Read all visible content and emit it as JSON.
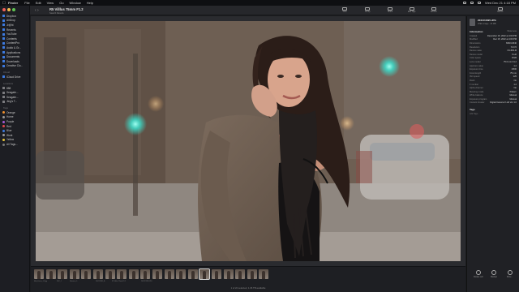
{
  "menubar": {
    "app": "Finder",
    "items": [
      "File",
      "Edit",
      "View",
      "Go",
      "Window",
      "Help"
    ],
    "clock": "Wed Dec 21 4:18 PM"
  },
  "sidebar": {
    "favorites_items": [
      "Dropbox",
      "AirDrop",
      "Jr@ht",
      "Recents",
      "YouTube",
      "Contents",
      "ContentPro",
      "Audio & Gr...",
      "Applications",
      "Documents",
      "Downloads",
      "Creative Clo..."
    ],
    "icloud_head": "iCloud",
    "icloud_items": [
      "iCloud Drive"
    ],
    "locations_head": "Locations",
    "locations_items": [
      "888",
      "Seagate...",
      "Seagate...",
      "Jing's T..."
    ],
    "tags_head": "Tags",
    "tags": [
      {
        "label": "Orange",
        "color": "#f0902c"
      },
      {
        "label": "Home",
        "color": "#9a9a9a"
      },
      {
        "label": "Purple",
        "color": "#a25ad6"
      },
      {
        "label": "Red",
        "color": "#e5484d"
      },
      {
        "label": "Blue",
        "color": "#3d7be0"
      },
      {
        "label": "Work",
        "color": "#9a9a9a"
      },
      {
        "label": "Yellow",
        "color": "#e8c53a"
      },
      {
        "label": "All Tags...",
        "color": "#777777"
      }
    ]
  },
  "toolbar": {
    "back": "‹ ›",
    "title": "R5 Villlus 75mm F1.2",
    "subtitle": "Search Results",
    "buttons": [
      "View",
      "Group",
      "Share",
      "Edit Tags",
      "Actions",
      "Search"
    ]
  },
  "inspector": {
    "filename": "20XCF3395.JPG",
    "filetype": "JPEG image · 23 MB",
    "info_title": "Information",
    "show_less": "Show Less",
    "rows": [
      {
        "k": "Created",
        "v": "December 15, 2022 at 4:00 PM"
      },
      {
        "k": "Modified",
        "v": "Dec 15, 2022 at 4:00 PM"
      },
      {
        "k": "Dimensions",
        "v": "6960×4640"
      },
      {
        "k": "Resolution",
        "v": "72×72"
      },
      {
        "k": "Device make",
        "v": "FUJIFILM"
      },
      {
        "k": "Device model",
        "v": "X-H2"
      },
      {
        "k": "Color space",
        "v": "RGB"
      },
      {
        "k": "Lens model",
        "v": "75.0 mm F1.2"
      },
      {
        "k": "Aperture value",
        "v": "1.2"
      },
      {
        "k": "Exposure time",
        "v": "1/500"
      },
      {
        "k": "Focal length",
        "v": "75 mm"
      },
      {
        "k": "ISO speed",
        "v": "125"
      },
      {
        "k": "Flash",
        "v": "No"
      },
      {
        "k": "F number",
        "v": "1.2"
      },
      {
        "k": "Alpha channel",
        "v": "No"
      },
      {
        "k": "Metering mode",
        "v": "Pattern"
      },
      {
        "k": "White balance",
        "v": "Manual"
      },
      {
        "k": "Exposure program",
        "v": "Manual"
      },
      {
        "k": "Content Creator",
        "v": "Digital Camera X-H2 Ver 1.0"
      }
    ],
    "tags_title": "Tags",
    "tags_add": "Add Tags..."
  },
  "filmstrip": {
    "labels": [
      "Matt_Ferres_1-3.jpg",
      "DSC_1",
      "Glasses_4...",
      "DSCF2081_B...",
      "R5 Villlus 75mm F1.2",
      "20XCF3395.JPG"
    ],
    "selected_index": 14
  },
  "statusbar": {
    "text": "1 of 22 selected, 1.06 TB available"
  },
  "bottom_actions": [
    "Rotate Left",
    "Markup",
    "More..."
  ]
}
